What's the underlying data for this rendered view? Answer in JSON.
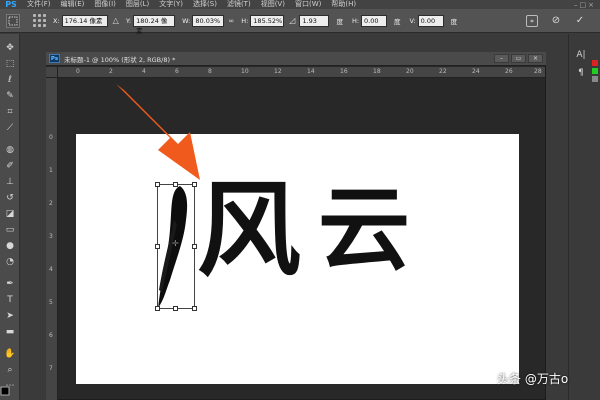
{
  "app": {
    "logo": "PS"
  },
  "menu": {
    "items": [
      "文件(F)",
      "编辑(E)",
      "图像(I)",
      "图层(L)",
      "文字(Y)",
      "选择(S)",
      "滤镜(T)",
      "视图(V)",
      "窗口(W)",
      "帮助(H)"
    ],
    "window_controls": [
      "–",
      "□",
      "×"
    ]
  },
  "options_bar": {
    "x_label": "X:",
    "x_value": "176.14 像素",
    "y_label": "Y:",
    "y_value": "180.24 像素",
    "w_label": "W:",
    "w_value": "80.03%",
    "h_label": "H:",
    "h_value": "185.52%",
    "angle_value": "1.93",
    "angle_unit": "度",
    "hskew_label": "H:",
    "hskew_value": "0.00",
    "hskew_unit": "度",
    "vskew_label": "V:",
    "vskew_value": "0.00",
    "vskew_unit": "度"
  },
  "document": {
    "icon": "Ps",
    "title": "未标题-1 @ 100% (形状 2, RGB/8) *",
    "ruler_top": [
      "0",
      "2",
      "4",
      "6",
      "8",
      "10",
      "12",
      "14",
      "16",
      "18",
      "20",
      "22",
      "24",
      "26",
      "28"
    ],
    "ruler_left": [
      "0",
      "1",
      "2",
      "3",
      "4",
      "5",
      "6",
      "7",
      "8",
      "9"
    ]
  },
  "canvas": {
    "char1": "风",
    "char2": "云"
  },
  "watermark": "头条 @万古o",
  "colors": {
    "arrow": "#f05a1c",
    "canvas": "#ffffff",
    "ink": "#111111"
  }
}
